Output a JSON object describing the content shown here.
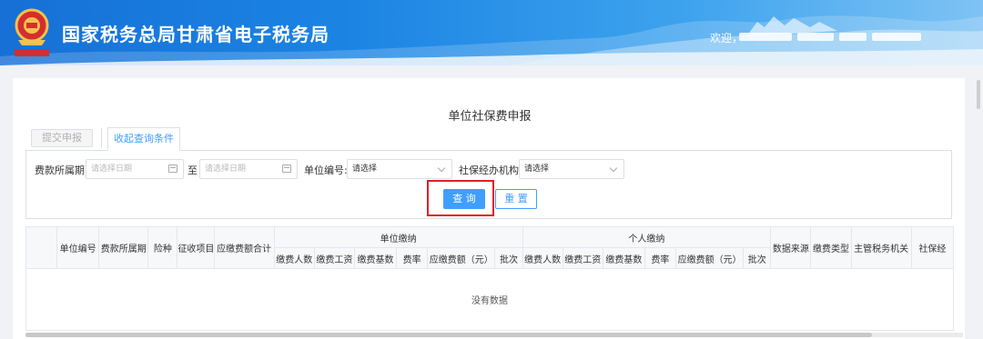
{
  "header": {
    "title": "国家税务总局甘肃省电子税务局",
    "welcome": "欢迎，",
    "logo_icon": "tax-emblem-icon"
  },
  "page": {
    "title": "单位社保费申报"
  },
  "tabs": {
    "submit": "提交申报",
    "query_conditions": "收起查询条件"
  },
  "filters": {
    "period_label": "费款所属期:",
    "period_start_placeholder": "请选择日期",
    "period_to": "至",
    "period_end_placeholder": "请选择日期",
    "unit_no_label": "单位编号:",
    "unit_no_value": "请选择",
    "agency_label": "社保经办机构:",
    "agency_value": "请选择"
  },
  "actions": {
    "query": "查 询",
    "reset": "重 置"
  },
  "table": {
    "columns": [
      "单位编号",
      "费款所属期",
      "险种",
      "征收项目",
      "应缴费额合计"
    ],
    "group_unit": "单位缴纳",
    "group_personal": "个人缴纳",
    "unit_cols": [
      "缴费人数",
      "缴费工资",
      "缴费基数",
      "费率",
      "应缴费额（元）",
      "批次"
    ],
    "personal_cols": [
      "缴费人数",
      "缴费工资",
      "缴费基数",
      "费率",
      "应缴费额（元）",
      "批次"
    ],
    "tail_cols": [
      "数据来源",
      "缴费类型",
      "主管税务机关",
      "社保经"
    ],
    "empty_text": "没有数据"
  },
  "colors": {
    "accent": "#409eff",
    "highlight": "#e02020",
    "header_start": "#1670d6"
  }
}
